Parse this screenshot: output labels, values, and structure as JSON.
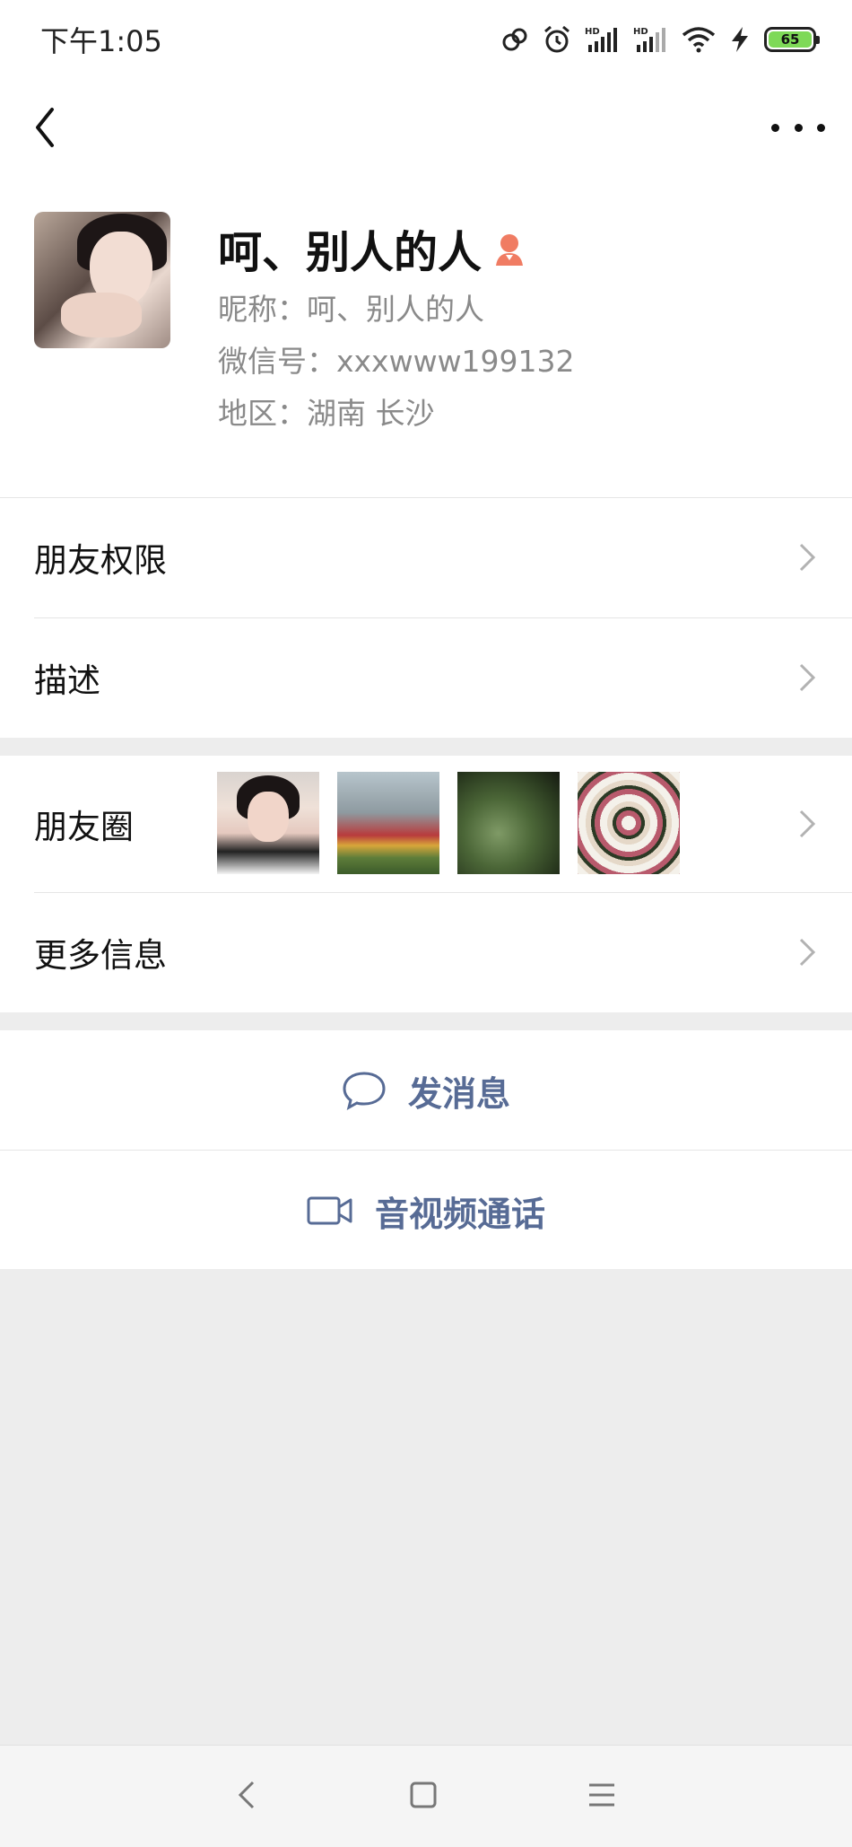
{
  "status_bar": {
    "time": "下午1:05",
    "battery_level": "65",
    "icons": [
      "link-icon",
      "alarm-icon",
      "hd-signal-icon",
      "hd-signal-icon",
      "wifi-icon",
      "charging-icon",
      "battery-icon"
    ]
  },
  "nav": {
    "back_icon": "chevron-left-icon",
    "more_icon": "more-dots-icon"
  },
  "profile": {
    "display_name": "呵、别人的人",
    "gender_icon": "female-icon",
    "nickname_line": "昵称：呵、别人的人",
    "wechat_id_line": "微信号：xxxwww199132",
    "region_line": "地区：湖南  长沙"
  },
  "settings": {
    "friend_permissions": "朋友权限",
    "description": "描述"
  },
  "moments": {
    "label": "朋友圈",
    "more_info": "更多信息"
  },
  "actions": {
    "send_message": "发消息",
    "video_call": "音视频通话"
  },
  "colors": {
    "link_blue": "#576b95",
    "background": "#ededed",
    "gender_female": "#f07c63"
  }
}
